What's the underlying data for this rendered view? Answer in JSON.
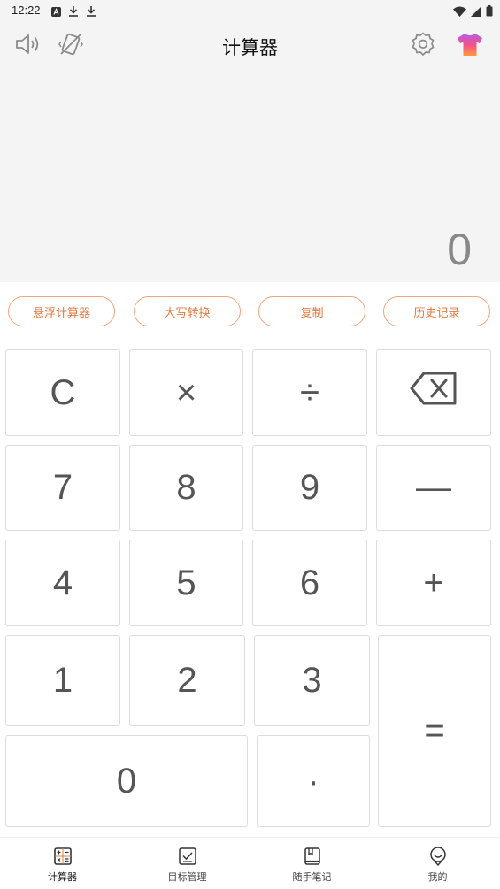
{
  "status_bar": {
    "time": "12:22"
  },
  "app_bar": {
    "title": "计算器"
  },
  "display": {
    "value": "0"
  },
  "function_buttons": [
    "悬浮计算器",
    "大写转换",
    "复制",
    "历史记录"
  ],
  "keypad": {
    "clear": "C",
    "multiply": "×",
    "divide": "÷",
    "seven": "7",
    "eight": "8",
    "nine": "9",
    "minus": "—",
    "four": "4",
    "five": "5",
    "six": "6",
    "plus": "+",
    "one": "1",
    "two": "2",
    "three": "3",
    "zero": "0",
    "dot": "·",
    "equals": "="
  },
  "bottom_nav": [
    {
      "label": "计算器",
      "icon": "calculator-icon",
      "active": true
    },
    {
      "label": "目标管理",
      "icon": "checkbox-icon",
      "active": false
    },
    {
      "label": "随手笔记",
      "icon": "notebook-icon",
      "active": false
    },
    {
      "label": "我的",
      "icon": "profile-icon",
      "active": false
    }
  ],
  "colors": {
    "accent": "#e4793f",
    "accent_border": "#f0a57c",
    "background": "#f4f4f4",
    "key_text": "#555555"
  }
}
